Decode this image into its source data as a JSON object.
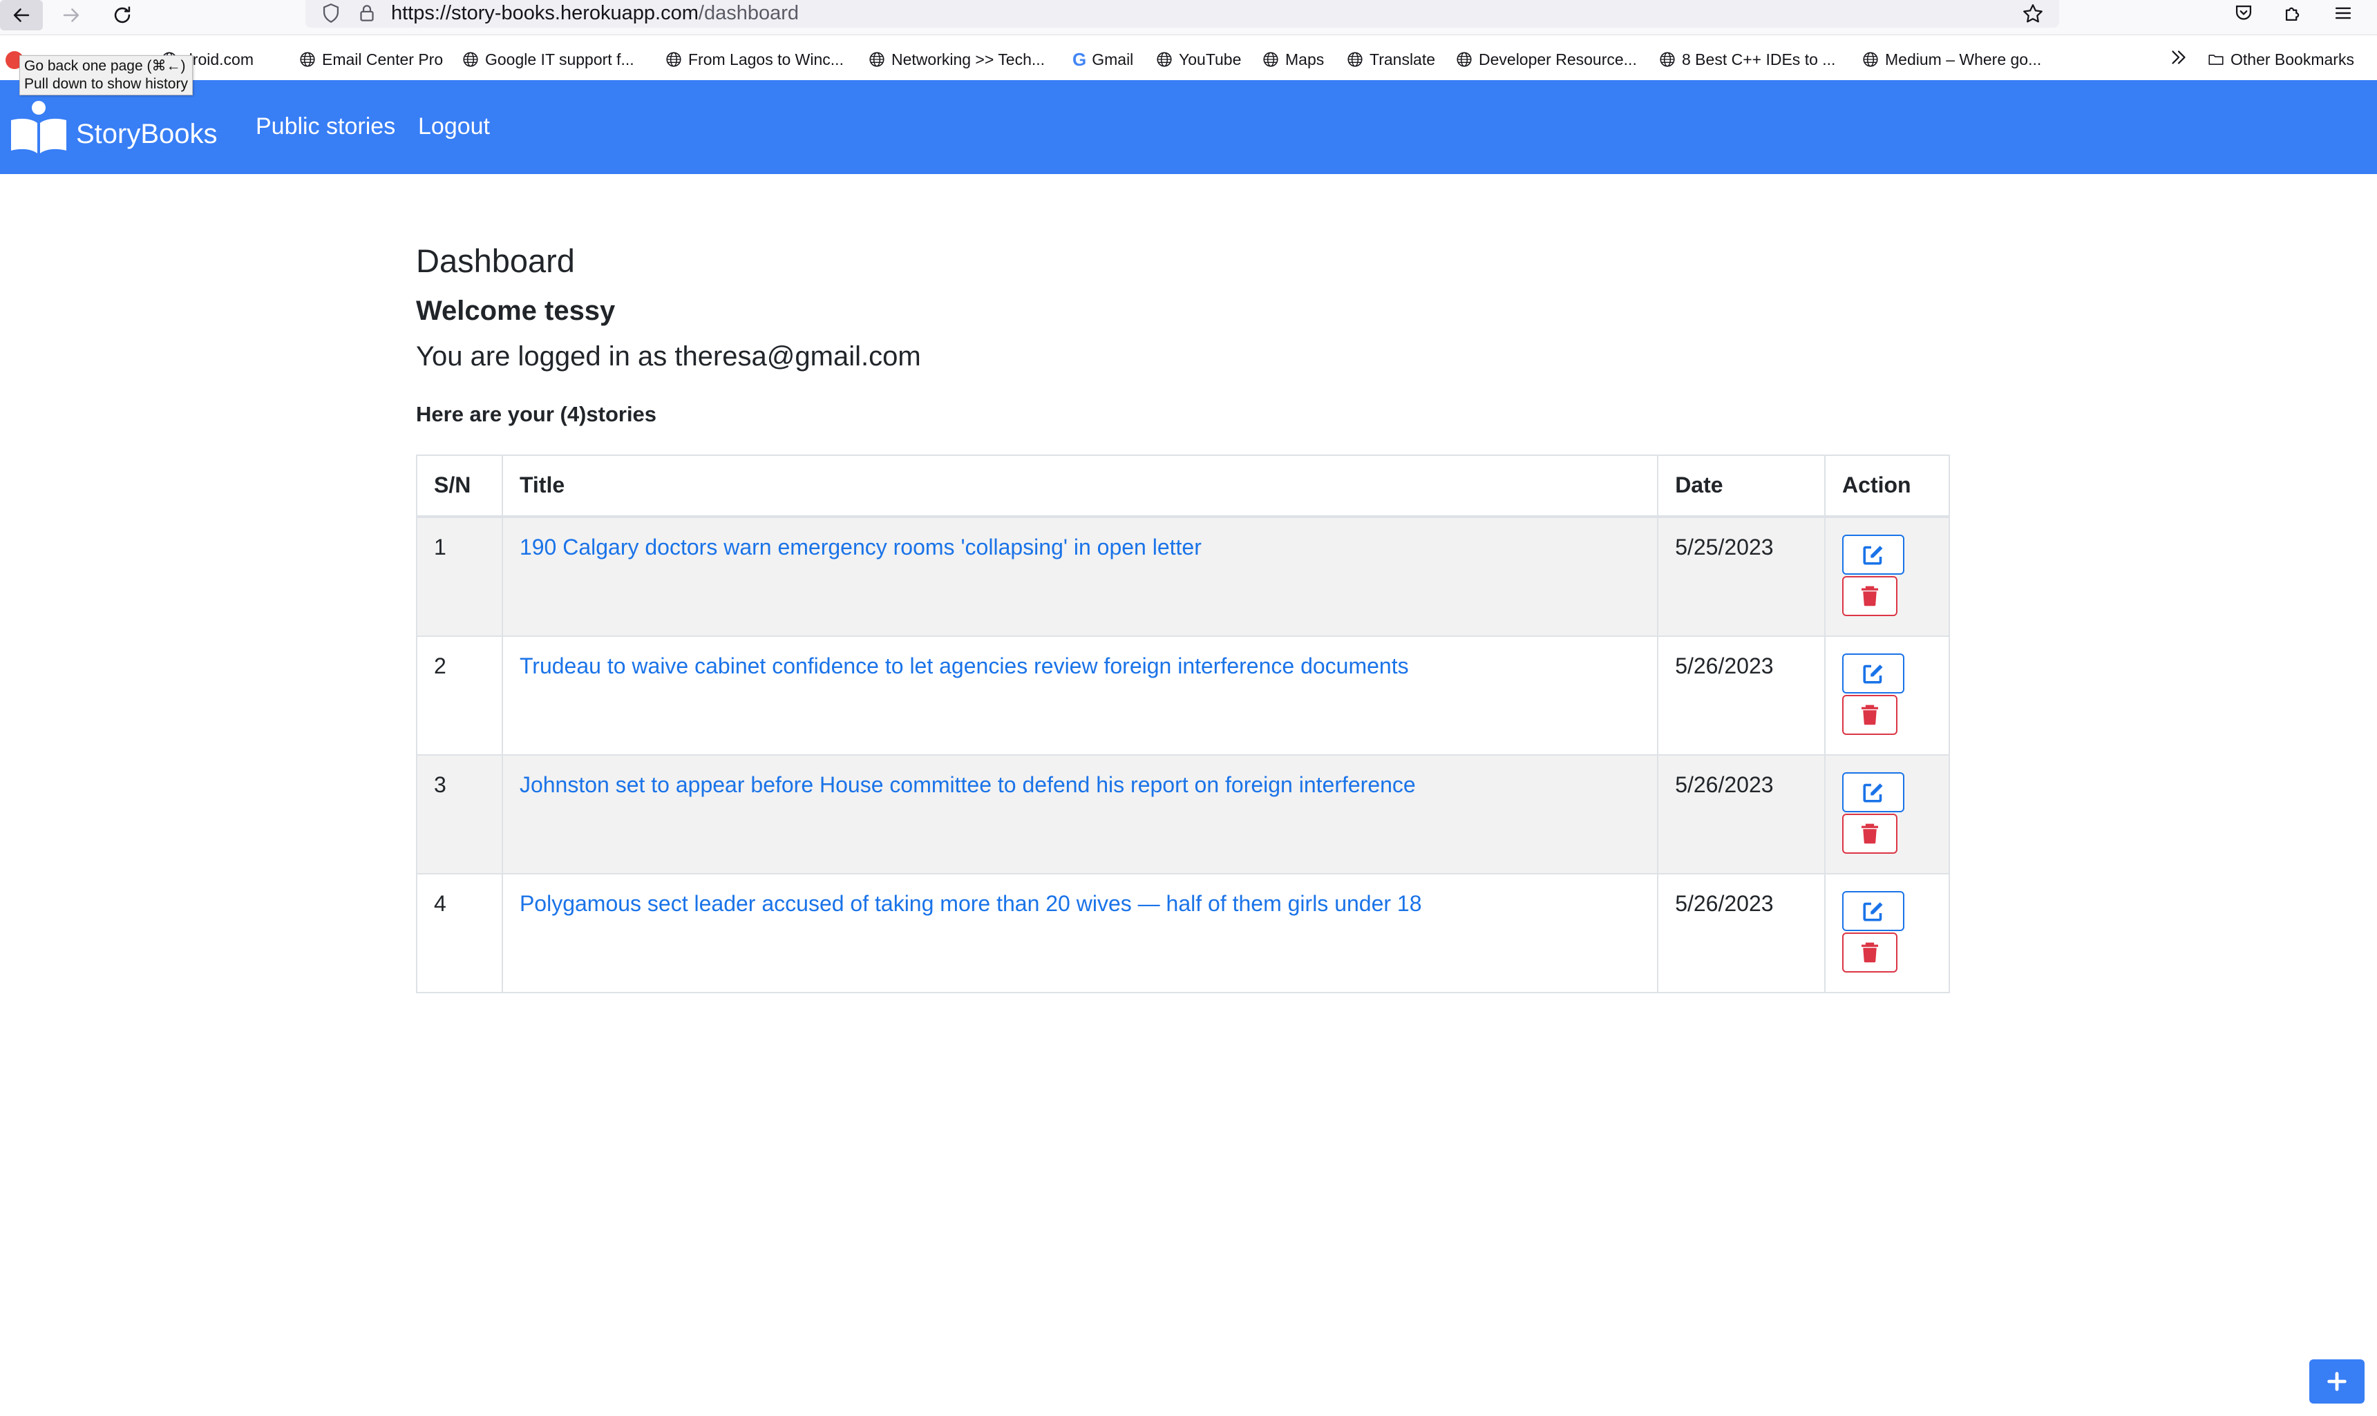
{
  "browser": {
    "url_scheme_host": "https://story-books.herokuapp.com",
    "url_path": "/dashboard",
    "tooltip": "Go back one page (⌘←)\nPull down to show history",
    "bookmarks": [
      {
        "label": "droid.com",
        "icon": "globe-icon"
      },
      {
        "label": "Email Center Pro",
        "icon": "globe-icon"
      },
      {
        "label": "Google IT support f...",
        "icon": "globe-icon"
      },
      {
        "label": "From Lagos to Winc...",
        "icon": "globe-icon"
      },
      {
        "label": "Networking >> Tech...",
        "icon": "globe-icon"
      },
      {
        "label": "Gmail",
        "icon": "google-g-icon"
      },
      {
        "label": "YouTube",
        "icon": "globe-icon"
      },
      {
        "label": "Maps",
        "icon": "globe-icon"
      },
      {
        "label": "Translate",
        "icon": "globe-icon"
      },
      {
        "label": "Developer Resource...",
        "icon": "globe-icon"
      },
      {
        "label": "8 Best C++ IDEs to ...",
        "icon": "globe-icon"
      },
      {
        "label": "Medium – Where go...",
        "icon": "globe-icon"
      }
    ],
    "other_bookmarks": "Other Bookmarks"
  },
  "navbar": {
    "brand": "StoryBooks",
    "links": [
      "Public stories",
      "Logout"
    ]
  },
  "dashboard": {
    "title": "Dashboard",
    "welcome": "Welcome tessy",
    "logged_in": "You are logged in as theresa@gmail.com",
    "count_text": "Here are your (4)stories",
    "columns": [
      "S/N",
      "Title",
      "Date",
      "Action"
    ],
    "rows": [
      {
        "sn": "1",
        "title": "190 Calgary doctors warn emergency rooms 'collapsing' in open letter",
        "date": "5/25/2023"
      },
      {
        "sn": "2",
        "title": "Trudeau to waive cabinet confidence to let agencies review foreign interference documents",
        "date": "5/26/2023"
      },
      {
        "sn": "3",
        "title": "Johnston set to appear before House committee to defend his report on foreign interference",
        "date": "5/26/2023"
      },
      {
        "sn": "4",
        "title": "Polygamous sect leader accused of taking more than 20 wives — half of them girls under 18",
        "date": "5/26/2023"
      }
    ]
  },
  "colors": {
    "navbar": "#387ef5",
    "link": "#1a73e8",
    "danger": "#dc3545",
    "stripe": "#f2f2f2"
  }
}
